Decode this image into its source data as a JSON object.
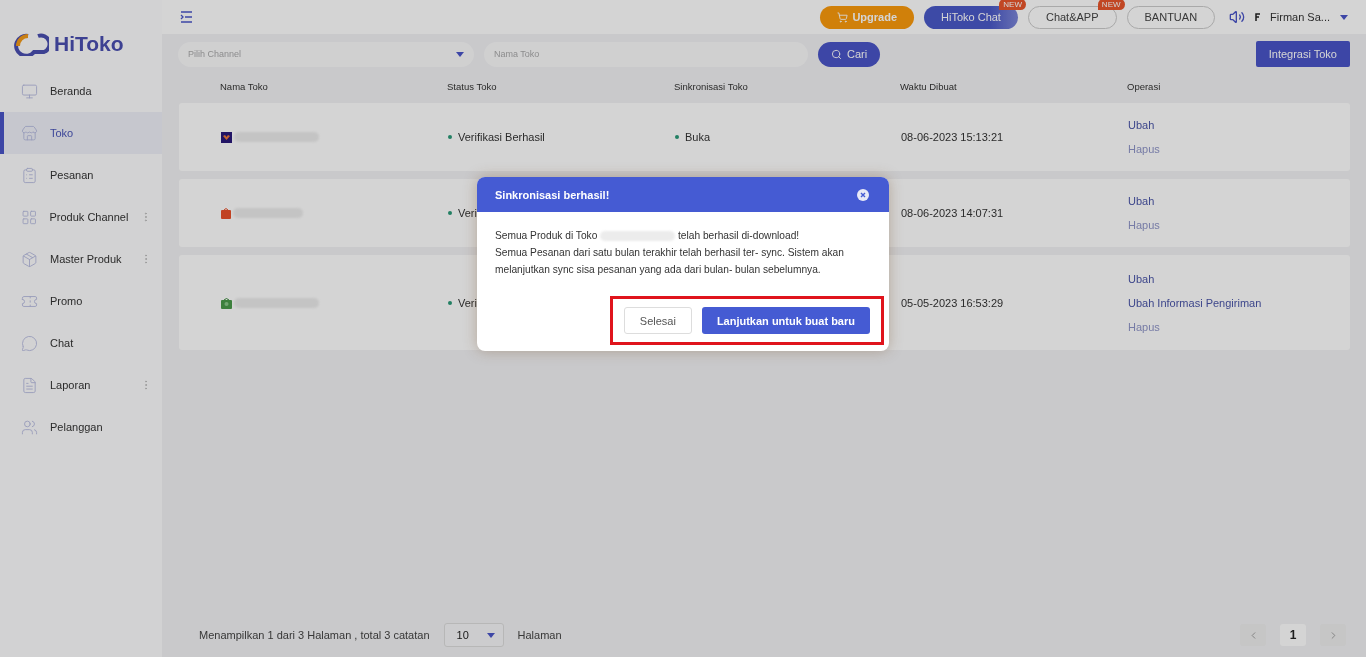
{
  "logo": {
    "text": "HiToko"
  },
  "sidebar": {
    "items": [
      {
        "label": "Beranda",
        "selected": false,
        "more": false
      },
      {
        "label": "Toko",
        "selected": true,
        "more": false
      },
      {
        "label": "Pesanan",
        "selected": false,
        "more": false
      },
      {
        "label": "Produk Channel",
        "selected": false,
        "more": true
      },
      {
        "label": "Master Produk",
        "selected": false,
        "more": true
      },
      {
        "label": "Promo",
        "selected": false,
        "more": false
      },
      {
        "label": "Chat",
        "selected": false,
        "more": false
      },
      {
        "label": "Laporan",
        "selected": false,
        "more": true
      },
      {
        "label": "Pelanggan",
        "selected": false,
        "more": false
      }
    ]
  },
  "topbar": {
    "buttons": [
      {
        "label": "Upgrade",
        "kind": "upgrade"
      },
      {
        "label": "HiToko Chat",
        "kind": "primary",
        "badge": "NEW"
      },
      {
        "label": "Chat&APP",
        "kind": "outline",
        "badge": "NEW"
      },
      {
        "label": "BANTUAN",
        "kind": "outline"
      }
    ],
    "user": "Firman Sa..."
  },
  "filters": {
    "channel": {
      "placeholder": "Pilih Channel"
    },
    "name": {
      "placeholder": "Nama Toko"
    },
    "search_button": "Cari",
    "integrate_button": "Integrasi Toko"
  },
  "table": {
    "columns": [
      "Nama Toko",
      "Status Toko",
      "Sinkronisasi Toko",
      "Waktu Dibuat",
      "Operasi"
    ],
    "rows": [
      {
        "status": "Verifikasi Berhasil",
        "sync": "Buka",
        "time": "08-06-2023 15:13:21",
        "operations": [
          {
            "label": "Ubah",
            "kind": "edit"
          },
          {
            "label": "Hapus",
            "kind": "delete"
          }
        ]
      },
      {
        "status": "Veri",
        "time": "08-06-2023 14:07:31",
        "operations": [
          {
            "label": "Ubah",
            "kind": "edit"
          },
          {
            "label": "Hapus",
            "kind": "delete"
          }
        ]
      },
      {
        "status": "Veri",
        "time": "05-05-2023 16:53:29",
        "operations": [
          {
            "label": "Ubah",
            "kind": "edit"
          },
          {
            "label": "Ubah Informasi Pengiriman",
            "kind": "edit"
          },
          {
            "label": "Hapus",
            "kind": "delete"
          }
        ]
      }
    ]
  },
  "pagination": {
    "summary": "Menampilkan 1 dari 3 Halaman , total 3 catatan",
    "page_size": "10",
    "page_size_label": "Halaman",
    "pages": [
      {
        "label": "1",
        "selected": true
      }
    ]
  },
  "modal": {
    "title": "Sinkronisasi berhasil!",
    "line1_before": "Semua Produk di Toko",
    "line1_after": "telah berhasil di-download!",
    "line2": "Semua Pesanan dari satu bulan terakhir telah berhasil ter- sync. Sistem akan melanjutkan sync sisa pesanan yang ada dari bulan- bulan sebelumnya.",
    "buttons": [
      {
        "label": "Selesai",
        "kind": "secondary"
      },
      {
        "label": "Lanjutkan untuk buat baru",
        "kind": "primary"
      }
    ],
    "highlighted": true
  }
}
